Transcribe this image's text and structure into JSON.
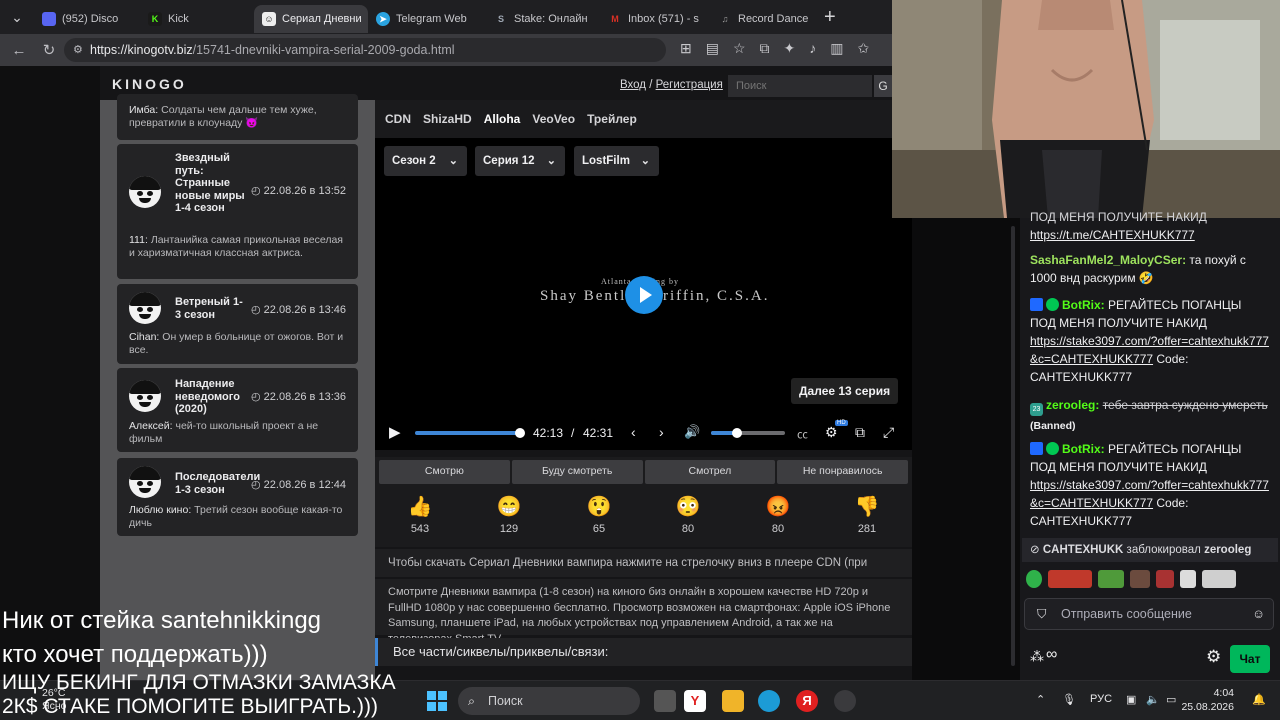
{
  "browser": {
    "tabs": [
      {
        "label": "(952) Disco",
        "badge": "952",
        "color": "#5865f2"
      },
      {
        "label": "Kick",
        "color": "#53fc18"
      },
      {
        "label": "Сериал Дневни",
        "color": "#ffffff"
      },
      {
        "label": "Telegram Web",
        "color": "#2aa3e0"
      },
      {
        "label": "Stake: Онлайн",
        "color": "#9fa7b3"
      },
      {
        "label": "Inbox (571) - s",
        "color": "#d93025"
      },
      {
        "label": "Record Dance",
        "color": "#9a9a9a"
      }
    ],
    "url_host": "https://kinogotv.biz",
    "url_path": "/15741-dnevniki-vampira-serial-2009-goda.html"
  },
  "site": {
    "logo": "KINOGO",
    "login": "Вход",
    "sep": " / ",
    "register": "Регистрация",
    "search_placeholder": "Поиск",
    "search_btn": "G"
  },
  "comments": [
    {
      "author": "Имба:",
      "text": "Солдаты чем дальше тем хуже, превратили в клоунаду 😈"
    },
    {
      "title": "Звездный путь: Странные новые миры 1-4 сезон",
      "date": "◴ 22.08.26 в 13:52",
      "author": "111:",
      "text": "Лантанийка самая прикольная веселая и харизматичная классная актриса."
    },
    {
      "title": "Ветреный 1-3 сезон",
      "date": "◴ 22.08.26 в 13:46",
      "author": "Cihan:",
      "text": "Он умер в больнице от ожогов. Вот и все."
    },
    {
      "title": "Нападение неведомого (2020)",
      "date": "◴ 22.08.26 в 13:36",
      "author": "Алексей:",
      "text": "чей-то школьный проект а не фильм"
    },
    {
      "title": "Последователи 1-3 сезон",
      "date": "◴ 22.08.26 в 12:44",
      "author": "Люблю кино:",
      "text": "Третий сезон вообще какая-то дичь"
    }
  ],
  "player": {
    "tabs": [
      "CDN",
      "ShizaHD",
      "Alloha",
      "VeoVeo",
      "Трейлер"
    ],
    "active_tab": "Alloha",
    "season": "Сезон 2",
    "episode": "Серия 12",
    "voice": "LostFilm",
    "credits_top": "Atlanta Casting by",
    "credits_name": "Shay Bentley Griffin, C.S.A.",
    "next_episode": "Далее 13 серия",
    "time_current": "42:13",
    "time_sep": "/",
    "time_total": "42:31",
    "progress": 0.993,
    "volume": 0.35,
    "hd_badge": "HD"
  },
  "status_buttons": [
    "Смотрю",
    "Буду смотреть",
    "Смотрел",
    "Не понравилось"
  ],
  "reactions": [
    {
      "emoji": "👍",
      "count": "543"
    },
    {
      "emoji": "😁",
      "count": "129"
    },
    {
      "emoji": "😲",
      "count": "65"
    },
    {
      "emoji": "😳",
      "count": "80"
    },
    {
      "emoji": "😡",
      "count": "80"
    },
    {
      "emoji": "👎",
      "count": "281"
    }
  ],
  "info": {
    "download": "Чтобы скачать Сериал Дневники вампира нажмите на стрелочку вниз в плеере CDN (при наличии)!",
    "description": "Смотрите Дневники вампира (1-8 сезон) на киного биз онлайн в хорошем качестве HD 720p и FullHD 1080p у нас совершенно бесплатно. Просмотр возможен на смартфонах: Apple iOS iPhone Samsung, планшете iPad, на любых устройствах под управлением Android, а так же на телевизорах Smart TV.",
    "parts": "Все части/сиквелы/приквелы/связи:"
  },
  "overlay": {
    "line1": "Ник от стейка santehnikkingg",
    "line2": "кто хочет поддержать)))",
    "line3": "ИЩУ БЕКИНГ ДЛЯ ОТМАЗКИ ЗАМАЗКА",
    "line4": "2К$ СТАКЕ ПОМОГИТЕ ВЫИГРАТЬ.)))"
  },
  "chat": {
    "messages": [
      {
        "user": "",
        "text": "ПОД МЕНЯ ПОЛУЧИТЕ НАКИД",
        "link": "https://t.me/CAHTEXHUKK777"
      },
      {
        "user": "SashaFanMel2_MaloyCSer:",
        "text": "та похуй с 1000 внд раскурим 🤣",
        "color": "#9ee35e"
      },
      {
        "user": "BotRix:",
        "text": "РЕГАЙТЕСЬ ПОГАНЦЫ ПОД МЕНЯ ПОЛУЧИТЕ НАКИД",
        "link": "https://stake3097.com/?offer=cahtexhukk777&c=CAHTEXHUKK777",
        "code": "Code: CAHTEXHUKK777",
        "color": "#53fc18"
      },
      {
        "user": "zerooleg:",
        "text": "тебе завтра суждено умереть",
        "banned": "(Banned)",
        "color": "#53fc18"
      },
      {
        "user": "BotRix:",
        "text": "РЕГАЙТЕСЬ ПОГАНЦЫ ПОД МЕНЯ ПОЛУЧИТЕ НАКИД",
        "link": "https://stake3097.com/?offer=cahtexhukk777&c=CAHTEXHUKK777",
        "code": "Code: CAHTEXHUKK777",
        "color": "#53fc18"
      }
    ],
    "blocked_user": "CAHTEXHUKK",
    "blocked_action": "заблокировал",
    "blocked_target": "zerooleg",
    "input_placeholder": "Отправить сообщение",
    "send_label": "Чат",
    "infinity": "∞"
  },
  "taskbar": {
    "weather_temp": "26°C",
    "weather_desc": "Ясно",
    "search": "Поиск",
    "lang": "РУС",
    "time": "4:04",
    "date": "25.08.2026"
  }
}
